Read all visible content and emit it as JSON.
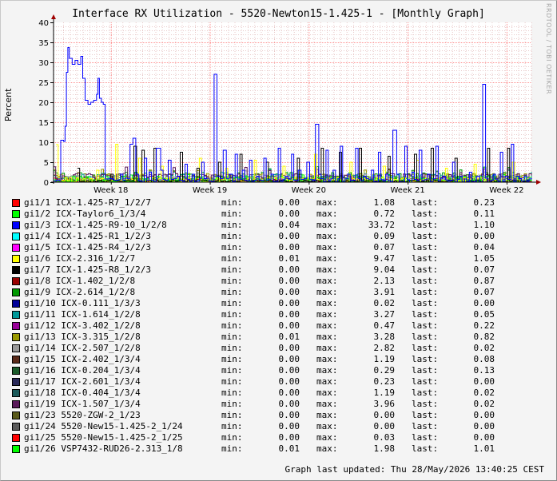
{
  "watermark": "RRDTOOL / TOBI OETIKER",
  "updated": "Graph last updated: Thu 28/May/2026 13:40:25 CEST",
  "chart_data": {
    "type": "line",
    "title": "Interface RX Utilization - 5520-Newton15-1.425-1 - [Monthly Graph]",
    "ylabel": "Percent",
    "xlabel": "",
    "ylim": [
      0,
      40
    ],
    "yticks": [
      0,
      5,
      10,
      15,
      20,
      25,
      30,
      35,
      40
    ],
    "xticks": [
      {
        "label": "Week 18",
        "t": 0.12
      },
      {
        "label": "Week 19",
        "t": 0.327
      },
      {
        "label": "Week 20",
        "t": 0.534
      },
      {
        "label": "Week 21",
        "t": 0.741
      },
      {
        "label": "Week 22",
        "t": 0.948
      }
    ],
    "grid": true,
    "legend_labels": {
      "min": "min:",
      "max": "max:",
      "last": "last:"
    },
    "series": [
      {
        "name": "gi1/1 ICX-1.425-R7_1/2/7",
        "color": "#ff0000",
        "min": "0.00",
        "max": "1.08",
        "last": "0.23"
      },
      {
        "name": "gi1/2 ICX-Taylor6_1/3/4",
        "color": "#00ff00",
        "min": "0.00",
        "max": "0.72",
        "last": "0.11"
      },
      {
        "name": "gi1/3 ICX-1.425-R9-10_1/2/8",
        "color": "#0000ff",
        "min": "0.04",
        "max": "33.72",
        "last": "1.10"
      },
      {
        "name": "gi1/4 ICX-1.425-R1_1/2/3",
        "color": "#00ffff",
        "min": "0.00",
        "max": "0.09",
        "last": "0.00"
      },
      {
        "name": "gi1/5 ICX-1.425-R4_1/2/3",
        "color": "#ff00ff",
        "min": "0.00",
        "max": "0.07",
        "last": "0.04"
      },
      {
        "name": "gi1/6 ICX-2.316_1/2/7",
        "color": "#ffff00",
        "min": "0.01",
        "max": "9.47",
        "last": "1.05"
      },
      {
        "name": "gi1/7 ICX-1.425-R8_1/2/3",
        "color": "#000000",
        "min": "0.00",
        "max": "9.04",
        "last": "0.07"
      },
      {
        "name": "gi1/8 ICX-1.402_1/2/8",
        "color": "#990000",
        "min": "0.00",
        "max": "2.13",
        "last": "0.87"
      },
      {
        "name": "gi1/9 ICX-2.614_1/2/8",
        "color": "#009900",
        "min": "0.00",
        "max": "3.91",
        "last": "0.07"
      },
      {
        "name": "gi1/10 ICX-0.111_1/3/3",
        "color": "#000099",
        "min": "0.00",
        "max": "0.02",
        "last": "0.00"
      },
      {
        "name": "gi1/11 ICX-1.614_1/2/8",
        "color": "#009999",
        "min": "0.00",
        "max": "3.27",
        "last": "0.05"
      },
      {
        "name": "gi1/12 ICX-3.402_1/2/8",
        "color": "#990099",
        "min": "0.00",
        "max": "0.47",
        "last": "0.22"
      },
      {
        "name": "gi1/13 ICX-3.315_1/2/8",
        "color": "#999900",
        "min": "0.01",
        "max": "3.28",
        "last": "0.82"
      },
      {
        "name": "gi1/14 ICX-2.507_1/2/8",
        "color": "#999999",
        "min": "0.00",
        "max": "2.82",
        "last": "0.02"
      },
      {
        "name": "gi1/15 ICX-2.402_1/3/4",
        "color": "#5a2a1a",
        "min": "0.00",
        "max": "1.19",
        "last": "0.08"
      },
      {
        "name": "gi1/16 ICX-0.204_1/3/4",
        "color": "#1a5a2a",
        "min": "0.00",
        "max": "0.29",
        "last": "0.13"
      },
      {
        "name": "gi1/17 ICX-2.601_1/3/4",
        "color": "#2a2a5a",
        "min": "0.00",
        "max": "0.23",
        "last": "0.00"
      },
      {
        "name": "gi1/18 ICX-0.404_1/3/4",
        "color": "#1a5a5a",
        "min": "0.00",
        "max": "1.19",
        "last": "0.02"
      },
      {
        "name": "gi1/19 ICX-1.507_1/3/4",
        "color": "#5a1a5a",
        "min": "0.00",
        "max": "3.96",
        "last": "0.02"
      },
      {
        "name": "gi1/23 5520-ZGW-2_1/23",
        "color": "#5a5a1a",
        "min": "0.00",
        "max": "0.00",
        "last": "0.00"
      },
      {
        "name": "gi1/24 5520-New15-1.425-2_1/24",
        "color": "#5a5a5a",
        "min": "0.00",
        "max": "0.00",
        "last": "0.00"
      },
      {
        "name": "gi1/25 5520-New15-1.425-2_1/25",
        "color": "#ff0000",
        "min": "0.00",
        "max": "0.03",
        "last": "0.00"
      },
      {
        "name": "gi1/26 VSP7432-RUD26-2.313_1/8",
        "color": "#00ff00",
        "min": "0.01",
        "max": "1.98",
        "last": "1.01"
      }
    ],
    "profile_gi1_3": [
      [
        0.0,
        0.3
      ],
      [
        0.012,
        0.5
      ],
      [
        0.015,
        10.5
      ],
      [
        0.021,
        10.2
      ],
      [
        0.024,
        14.0
      ],
      [
        0.027,
        27.5
      ],
      [
        0.03,
        33.7
      ],
      [
        0.033,
        31.0
      ],
      [
        0.039,
        29.5
      ],
      [
        0.045,
        30.5
      ],
      [
        0.051,
        29.5
      ],
      [
        0.057,
        31.5
      ],
      [
        0.061,
        26.0
      ],
      [
        0.066,
        20.5
      ],
      [
        0.072,
        19.5
      ],
      [
        0.078,
        20.0
      ],
      [
        0.084,
        20.5
      ],
      [
        0.09,
        22.0
      ],
      [
        0.093,
        26.0
      ],
      [
        0.096,
        21.0
      ],
      [
        0.1,
        20.0
      ],
      [
        0.104,
        19.5
      ],
      [
        0.108,
        0.8
      ],
      [
        0.14,
        2.0
      ],
      [
        0.15,
        1.0
      ],
      [
        0.16,
        9.5
      ],
      [
        0.166,
        11.0
      ],
      [
        0.172,
        2.0
      ],
      [
        0.19,
        6.0
      ],
      [
        0.2,
        2.5
      ],
      [
        0.215,
        8.5
      ],
      [
        0.224,
        3.0
      ],
      [
        0.24,
        5.5
      ],
      [
        0.258,
        1.5
      ],
      [
        0.275,
        4.5
      ],
      [
        0.29,
        2.0
      ],
      [
        0.31,
        5.0
      ],
      [
        0.32,
        1.0
      ],
      [
        0.336,
        27.0
      ],
      [
        0.342,
        1.5
      ],
      [
        0.355,
        8.0
      ],
      [
        0.368,
        2.0
      ],
      [
        0.38,
        7.0
      ],
      [
        0.395,
        3.0
      ],
      [
        0.41,
        5.5
      ],
      [
        0.425,
        1.5
      ],
      [
        0.44,
        6.0
      ],
      [
        0.455,
        2.0
      ],
      [
        0.47,
        8.5
      ],
      [
        0.485,
        1.5
      ],
      [
        0.498,
        7.0
      ],
      [
        0.512,
        3.0
      ],
      [
        0.53,
        5.0
      ],
      [
        0.548,
        14.5
      ],
      [
        0.555,
        2.0
      ],
      [
        0.57,
        8.0
      ],
      [
        0.585,
        3.0
      ],
      [
        0.6,
        9.0
      ],
      [
        0.615,
        2.0
      ],
      [
        0.632,
        8.5
      ],
      [
        0.648,
        1.5
      ],
      [
        0.665,
        3.0
      ],
      [
        0.68,
        7.5
      ],
      [
        0.695,
        2.0
      ],
      [
        0.71,
        13.0
      ],
      [
        0.718,
        2.0
      ],
      [
        0.735,
        9.0
      ],
      [
        0.75,
        2.5
      ],
      [
        0.765,
        8.0
      ],
      [
        0.782,
        2.0
      ],
      [
        0.8,
        9.0
      ],
      [
        0.815,
        1.5
      ],
      [
        0.835,
        5.0
      ],
      [
        0.85,
        1.5
      ],
      [
        0.87,
        2.5
      ],
      [
        0.885,
        1.5
      ],
      [
        0.898,
        24.5
      ],
      [
        0.904,
        1.0
      ],
      [
        0.92,
        2.0
      ],
      [
        0.935,
        7.5
      ],
      [
        0.945,
        1.5
      ],
      [
        0.958,
        9.5
      ],
      [
        0.968,
        1.5
      ],
      [
        0.985,
        1.5
      ],
      [
        1.0,
        1.1
      ]
    ],
    "profile_gi1_7": [
      [
        0.05,
        3.5
      ],
      [
        0.12,
        2.0
      ],
      [
        0.168,
        9.0
      ],
      [
        0.185,
        8.0
      ],
      [
        0.21,
        8.5
      ],
      [
        0.265,
        7.5
      ],
      [
        0.3,
        3.5
      ],
      [
        0.345,
        5.0
      ],
      [
        0.39,
        7.0
      ],
      [
        0.445,
        5.0
      ],
      [
        0.51,
        6.0
      ],
      [
        0.56,
        8.5
      ],
      [
        0.598,
        7.5
      ],
      [
        0.64,
        8.5
      ],
      [
        0.7,
        6.5
      ],
      [
        0.755,
        7.0
      ],
      [
        0.79,
        8.5
      ],
      [
        0.84,
        6.0
      ],
      [
        0.908,
        8.5
      ],
      [
        0.95,
        8.5
      ]
    ],
    "profile_gi1_6": [
      [
        0.005,
        9.4
      ],
      [
        0.09,
        3.0
      ],
      [
        0.13,
        9.5
      ],
      [
        0.178,
        6.0
      ],
      [
        0.225,
        4.0
      ],
      [
        0.305,
        6.0
      ],
      [
        0.36,
        3.5
      ],
      [
        0.42,
        5.5
      ],
      [
        0.48,
        4.0
      ],
      [
        0.546,
        7.0
      ],
      [
        0.62,
        5.0
      ],
      [
        0.69,
        4.0
      ],
      [
        0.76,
        5.5
      ],
      [
        0.82,
        3.5
      ],
      [
        0.88,
        4.5
      ],
      [
        0.96,
        5.0
      ]
    ],
    "profile_gi1_26": [
      [
        0.022,
        1.2
      ],
      [
        0.04,
        1.5
      ],
      [
        0.1,
        1.0
      ],
      [
        0.16,
        1.8
      ],
      [
        0.22,
        1.3
      ],
      [
        0.28,
        1.9
      ],
      [
        0.34,
        1.2
      ],
      [
        0.4,
        1.6
      ],
      [
        0.46,
        1.1
      ],
      [
        0.52,
        1.8
      ],
      [
        0.58,
        1.4
      ],
      [
        0.64,
        1.2
      ],
      [
        0.7,
        1.9
      ],
      [
        0.76,
        1.1
      ],
      [
        0.82,
        1.6
      ],
      [
        0.88,
        1.3
      ],
      [
        0.94,
        1.9
      ],
      [
        1.0,
        1.0
      ]
    ]
  }
}
